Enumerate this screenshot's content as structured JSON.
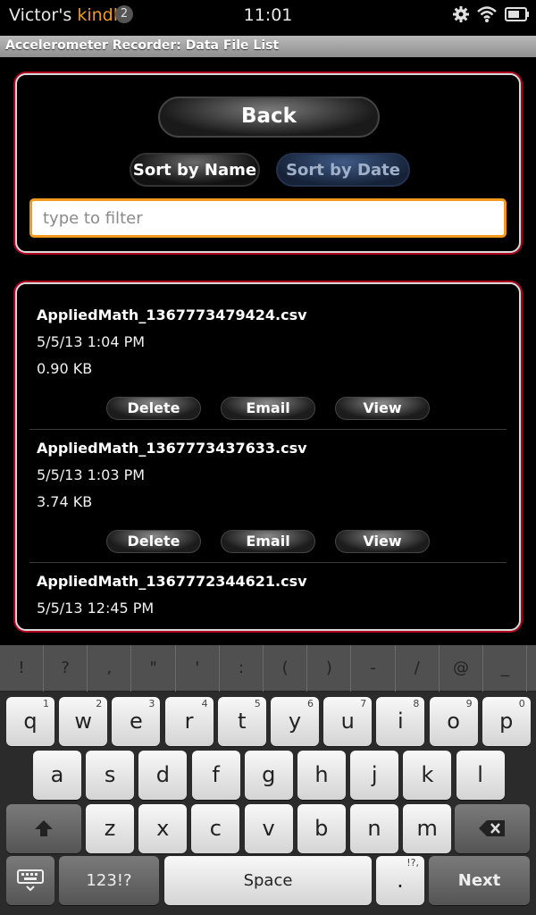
{
  "status_bar": {
    "owner_prefix": "Victor's ",
    "owner_brand": "kindle",
    "notification_count": "2",
    "time": "11:01"
  },
  "app": {
    "title": "Accelerometer Recorder: Data File List"
  },
  "controls": {
    "back_label": "Back",
    "sort_name_label": "Sort by Name",
    "sort_date_label": "Sort by Date",
    "filter_placeholder": "type to filter"
  },
  "files": [
    {
      "name": "AppliedMath_1367773479424.csv",
      "date": "5/5/13 1:04 PM",
      "size": "0.90 KB"
    },
    {
      "name": "AppliedMath_1367773437633.csv",
      "date": "5/5/13 1:03 PM",
      "size": "3.74 KB"
    },
    {
      "name": "AppliedMath_1367772344621.csv",
      "date": "5/5/13 12:45 PM",
      "size": ""
    }
  ],
  "file_actions": {
    "delete": "Delete",
    "email": "Email",
    "view": "View"
  },
  "keyboard": {
    "symbols": [
      "!",
      "?",
      ",",
      "\"",
      "'",
      ":",
      "(",
      ")",
      "-",
      "/",
      "@",
      "_"
    ],
    "row1": [
      {
        "k": "q",
        "h": "1"
      },
      {
        "k": "w",
        "h": "2"
      },
      {
        "k": "e",
        "h": "3"
      },
      {
        "k": "r",
        "h": "4"
      },
      {
        "k": "t",
        "h": "5"
      },
      {
        "k": "y",
        "h": "6"
      },
      {
        "k": "u",
        "h": "7"
      },
      {
        "k": "i",
        "h": "8"
      },
      {
        "k": "o",
        "h": "9"
      },
      {
        "k": "p",
        "h": "0"
      }
    ],
    "row2": [
      "a",
      "s",
      "d",
      "f",
      "g",
      "h",
      "j",
      "k",
      "l"
    ],
    "row3": [
      "z",
      "x",
      "c",
      "v",
      "b",
      "n",
      "m"
    ],
    "mode_label": "123!?",
    "space_label": "Space",
    "period_label": ".",
    "period_hint": "!?,",
    "next_label": "Next"
  },
  "colors": {
    "accent": "#f39a1e",
    "panel_border": "#b00020",
    "sort_active": "#162238"
  }
}
